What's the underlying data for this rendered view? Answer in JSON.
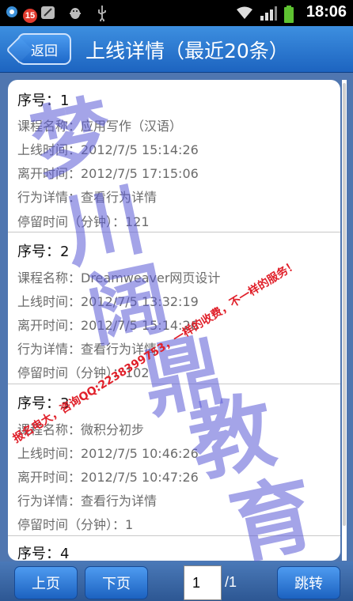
{
  "status_bar": {
    "notification_count": "15",
    "time": "18:06",
    "icons": [
      "app-icon",
      "leaf-icon",
      "android-debug-icon",
      "usb-icon",
      "wifi-icon",
      "signal-icon",
      "battery-icon"
    ]
  },
  "header": {
    "back_label": "返回",
    "title": "上线详情（最近20条）"
  },
  "records": [
    {
      "no_label": "序号：1",
      "course": "课程名称：应用写作（汉语）",
      "online": "上线时间：2012/7/5 15:14:26",
      "offline": "离开时间：2012/7/5 17:15:06",
      "action": "行为详情：查看行为详情",
      "stay": "停留时间（分钟）：121"
    },
    {
      "no_label": "序号：2",
      "course": "课程名称：Dreamweaver网页设计",
      "online": "上线时间：2012/7/5 13:32:19",
      "offline": "离开时间：2012/7/5 15:14:26",
      "action": "行为详情：查看行为详情",
      "stay": "停留时间（分钟）：102"
    },
    {
      "no_label": "序号：3",
      "course": "课程名称：微积分初步",
      "online": "上线时间：2012/7/5 10:46:26",
      "offline": "离开时间：2012/7/5 10:47:26",
      "action": "行为详情：查看行为详情",
      "stay": "停留时间（分钟）：1"
    },
    {
      "no_label": "序号：4"
    }
  ],
  "watermark": {
    "big_chars": [
      "梦",
      "川",
      "阔",
      "鼎",
      "教",
      "育"
    ],
    "text_1": "报名电大，咨询QQ:2238399753，一样的收费，不一样的服务！"
  },
  "footer": {
    "prev_label": "上页",
    "next_label": "下页",
    "page_value": "1",
    "page_total": "/1",
    "jump_label": "跳转"
  },
  "colors": {
    "header_blue": "#2a78d6",
    "button_blue": "#1d68c9",
    "watermark_blue": "#5a5ad6",
    "watermark_red": "#e0202a"
  }
}
